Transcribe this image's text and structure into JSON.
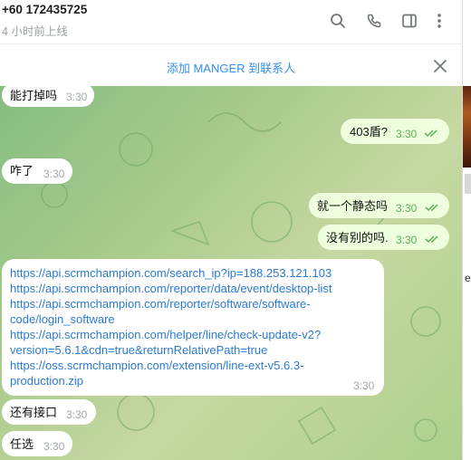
{
  "header": {
    "contact_name": "+60 172435725",
    "last_seen": "4 小时前上线"
  },
  "pin_bar": {
    "add_contact_label": "添加 MANGER 到联系人"
  },
  "messages": [
    {
      "text": "能打掉吗",
      "time": "3:30",
      "direction": "incoming"
    },
    {
      "text": "403盾?",
      "time": "3:30",
      "direction": "outgoing",
      "read": true
    },
    {
      "text": "咋了",
      "time": "3:30",
      "direction": "incoming"
    },
    {
      "text": "就一个静态吗",
      "time": "3:30",
      "direction": "outgoing",
      "read": true
    },
    {
      "text": "没有别的吗.",
      "time": "3:30",
      "direction": "outgoing",
      "read": true
    },
    {
      "lines": [
        "https://api.scrmchampion.com/search_ip?ip=188.253.121.103",
        "https://api.scrmchampion.com/reporter/data/event/desktop-list",
        "https://api.scrmchampion.com/reporter/software/software-",
        "code/login_software",
        "https://api.scrmchampion.com/helper/line/check-update-v2?",
        "version=5.6.1&cdn=true&returnRelativePath=true",
        "https://oss.scrmchampion.com/extension/line-ext-v5.6.3-",
        "production.zip"
      ],
      "time": "3:30",
      "direction": "incoming"
    },
    {
      "text": "还有接口",
      "time": "3:30",
      "direction": "incoming"
    },
    {
      "text": "任选",
      "time": "3:30",
      "direction": "incoming"
    }
  ],
  "side_panel": {
    "peek_text": "ex"
  },
  "icons": [
    "search-icon",
    "phone-icon",
    "sidebar-toggle-icon",
    "more-vertical-icon",
    "close-icon",
    "double-check-icon"
  ],
  "colors": {
    "accent": "#3390ec",
    "outgoing_bubble": "#eeffde",
    "read_check": "#5eae5a",
    "link": "#2b7bd1"
  }
}
